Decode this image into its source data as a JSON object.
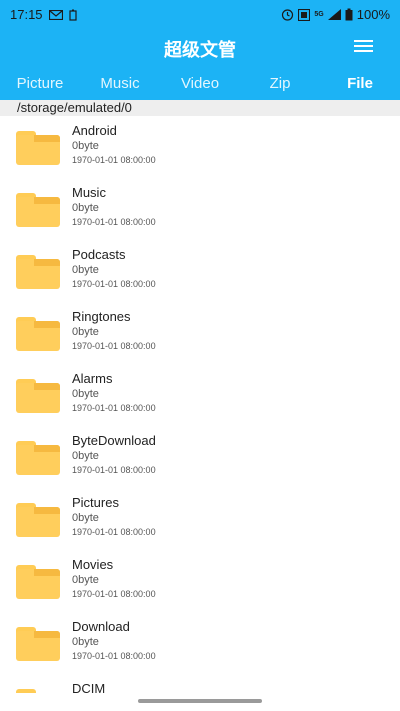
{
  "status_bar": {
    "time": "17:15",
    "battery": "100%",
    "network": "5G",
    "icons_left": [
      "mail-icon",
      "battery-saver-icon"
    ],
    "icons_right": [
      "alarm-icon",
      "hd-icon",
      "network-5g-icon",
      "signal-icon",
      "battery-icon"
    ]
  },
  "app": {
    "title": "超级文管"
  },
  "tabs": [
    {
      "label": "Picture",
      "active": false
    },
    {
      "label": "Music",
      "active": false
    },
    {
      "label": "Video",
      "active": false
    },
    {
      "label": "Zip",
      "active": false
    },
    {
      "label": "File",
      "active": true
    }
  ],
  "path": "/storage/emulated/0",
  "folders": [
    {
      "name": "Android",
      "size": "0byte",
      "date": "1970-01-01 08:00:00"
    },
    {
      "name": "Music",
      "size": "0byte",
      "date": "1970-01-01 08:00:00"
    },
    {
      "name": "Podcasts",
      "size": "0byte",
      "date": "1970-01-01 08:00:00"
    },
    {
      "name": "Ringtones",
      "size": "0byte",
      "date": "1970-01-01 08:00:00"
    },
    {
      "name": "Alarms",
      "size": "0byte",
      "date": "1970-01-01 08:00:00"
    },
    {
      "name": "ByteDownload",
      "size": "0byte",
      "date": "1970-01-01 08:00:00"
    },
    {
      "name": "Pictures",
      "size": "0byte",
      "date": "1970-01-01 08:00:00"
    },
    {
      "name": "Movies",
      "size": "0byte",
      "date": "1970-01-01 08:00:00"
    },
    {
      "name": "Download",
      "size": "0byte",
      "date": "1970-01-01 08:00:00"
    },
    {
      "name": "DCIM",
      "size": "",
      "date": ""
    }
  ],
  "colors": {
    "accent": "#1cb3f5",
    "folder": "#ffce5c",
    "path_bar": "#eeeeee"
  }
}
